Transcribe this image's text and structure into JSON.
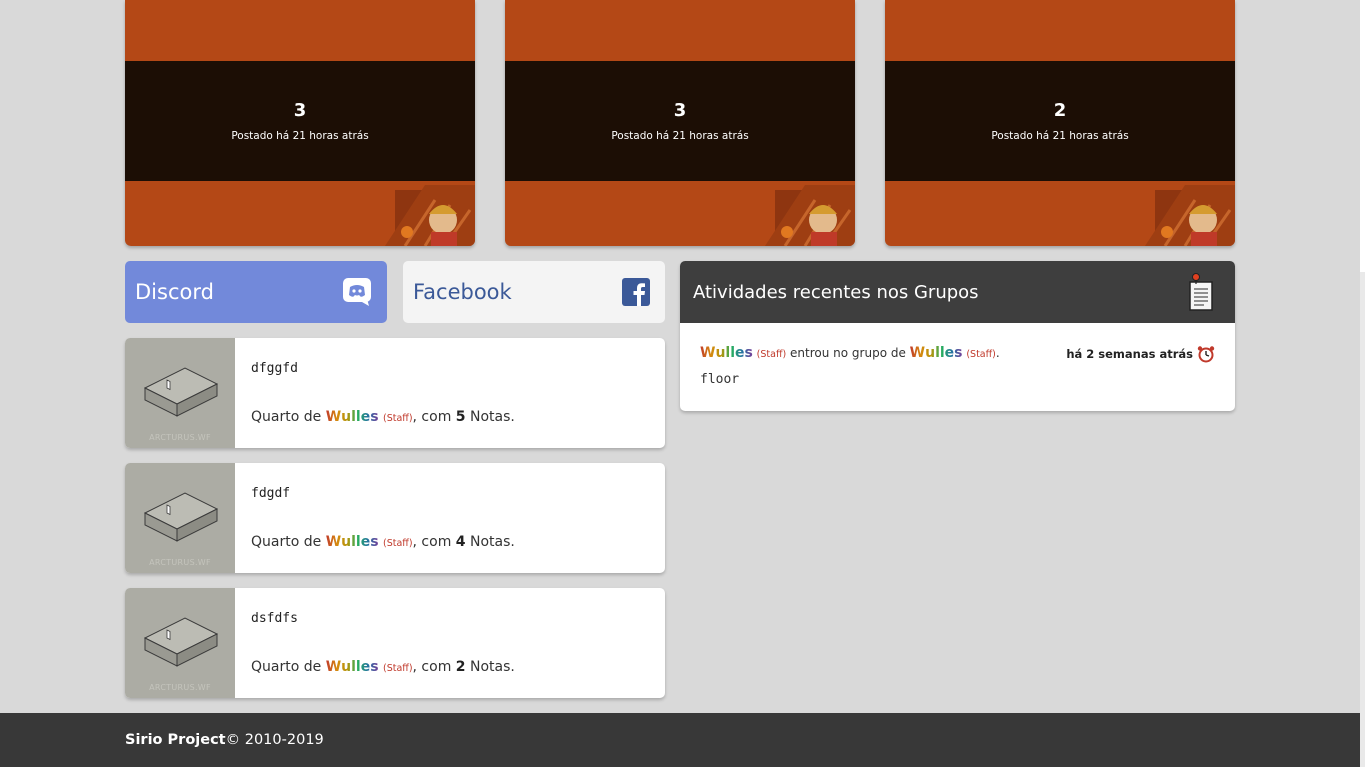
{
  "news": [
    {
      "title": "3",
      "date": "Postado há 21 horas atrás"
    },
    {
      "title": "3",
      "date": "Postado há 21 horas atrás"
    },
    {
      "title": "2",
      "date": "Postado há 21 horas atrás"
    }
  ],
  "social": {
    "discord_label": "Discord",
    "facebook_label": "Facebook"
  },
  "rooms": [
    {
      "name": "dfggfd",
      "prefix": "Quarto de ",
      "owner": "Wulles",
      "staff": "(Staff)",
      "mid": ", com ",
      "count": "5",
      "suffix": " Notas.",
      "watermark": "ARCTURUS.WF"
    },
    {
      "name": "fdgdf",
      "prefix": "Quarto de ",
      "owner": "Wulles",
      "staff": "(Staff)",
      "mid": ", com ",
      "count": "4",
      "suffix": " Notas.",
      "watermark": "ARCTURUS.WF"
    },
    {
      "name": "dsfdfs",
      "prefix": "Quarto de ",
      "owner": "Wulles",
      "staff": "(Staff)",
      "mid": ", com ",
      "count": "2",
      "suffix": " Notas.",
      "watermark": "ARCTURUS.WF"
    }
  ],
  "activity": {
    "title": "Atividades recentes nos Grupos",
    "user": "Wulles",
    "user_staff": "(Staff)",
    "action": " entrou no grupo de ",
    "group_owner": "Wulles",
    "group_owner_staff": "(Staff)",
    "end": ".",
    "time": "há 2 semanas atrás",
    "group_name": "floor"
  },
  "footer": {
    "brand": "Sirio Project",
    "copyright": " © 2010-2019"
  },
  "colors": {
    "news_orange": "#b44816",
    "news_band": "#1c0e05",
    "discord": "#7289da",
    "facebook": "#3b5998",
    "footer": "#383838",
    "header_dark": "#3e3e3e"
  }
}
